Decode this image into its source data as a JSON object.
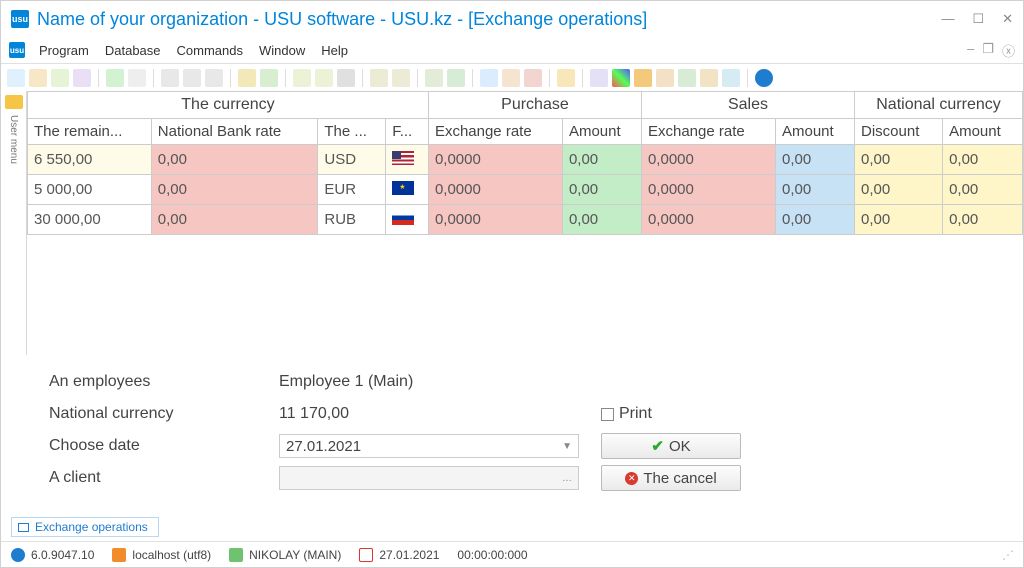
{
  "window": {
    "title": "Name of your organization - USU software - USU.kz - [Exchange operations]",
    "app_icon_text": "usu"
  },
  "menubar": {
    "items": [
      "Program",
      "Database",
      "Commands",
      "Window",
      "Help"
    ]
  },
  "sidebar": {
    "label": "User menu"
  },
  "grid": {
    "groups": [
      "The currency",
      "Purchase",
      "Sales",
      "National currency"
    ],
    "columns": [
      "The remain...",
      "National Bank rate",
      "The ...",
      "F...",
      "Exchange rate",
      "Amount",
      "Exchange rate",
      "Amount",
      "Discount",
      "Amount"
    ],
    "rows": [
      {
        "remain": "6 550,00",
        "nb_rate": "0,00",
        "cur": "USD",
        "flag": "usd",
        "p_rate": "0,0000",
        "p_amount": "0,00",
        "s_rate": "0,0000",
        "s_amount": "0,00",
        "disc": "0,00",
        "n_amount": "0,00"
      },
      {
        "remain": "5 000,00",
        "nb_rate": "0,00",
        "cur": "EUR",
        "flag": "eur",
        "p_rate": "0,0000",
        "p_amount": "0,00",
        "s_rate": "0,0000",
        "s_amount": "0,00",
        "disc": "0,00",
        "n_amount": "0,00"
      },
      {
        "remain": "30 000,00",
        "nb_rate": "0,00",
        "cur": "RUB",
        "flag": "rub",
        "p_rate": "0,0000",
        "p_amount": "0,00",
        "s_rate": "0,0000",
        "s_amount": "0,00",
        "disc": "0,00",
        "n_amount": "0,00"
      }
    ]
  },
  "form": {
    "employees_label": "An employees",
    "employees_value": "Employee 1 (Main)",
    "natcur_label": "National currency",
    "natcur_value": "11 170,00",
    "date_label": "Choose date",
    "date_value": "27.01.2021",
    "client_label": "A client",
    "client_value": "",
    "print_label": "Print",
    "ok_label": "OK",
    "cancel_label": "The cancel"
  },
  "tabs": {
    "active": "Exchange operations"
  },
  "status": {
    "version": "6.0.9047.10",
    "host": "localhost (utf8)",
    "user": "NIKOLAY (MAIN)",
    "date": "27.01.2021",
    "time": "00:00:00:000"
  }
}
